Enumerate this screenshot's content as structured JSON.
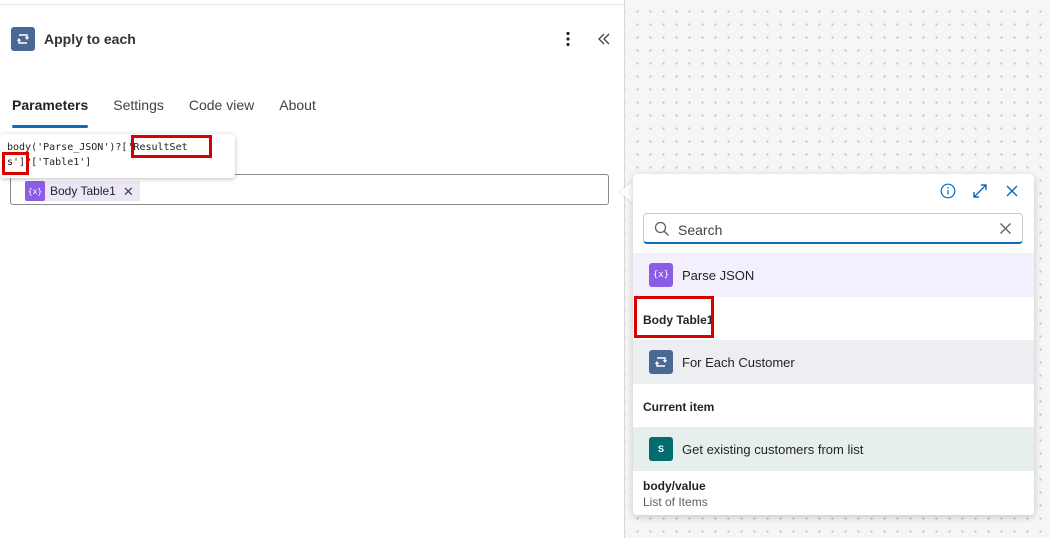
{
  "header": {
    "title": "Apply to each",
    "icon": "loop-icon"
  },
  "tabs": [
    {
      "label": "Parameters",
      "active": true
    },
    {
      "label": "Settings",
      "active": false
    },
    {
      "label": "Code view",
      "active": false
    },
    {
      "label": "About",
      "active": false
    }
  ],
  "tooltip": {
    "line1": "body('Parse_JSON')?['ResultSet",
    "line2": "s']?['Table1']"
  },
  "input": {
    "token_label": "Body Table1",
    "token_icon": "expression-icon"
  },
  "picker": {
    "search_placeholder": "Search",
    "groups": [
      {
        "label": "Parse JSON",
        "icon": "expression-icon",
        "color": "#8a5de6",
        "bg": "#f3effc"
      },
      {
        "label": "For Each Customer",
        "icon": "loop-icon",
        "color": "#486991",
        "bg": "#eceef2"
      },
      {
        "label": "Get existing customers from list",
        "icon": "sharepoint-icon",
        "color": "#036c70",
        "bg": "#e7eeee"
      }
    ],
    "items": [
      {
        "label": "Body Table1",
        "sub": ""
      },
      {
        "label": "Current item",
        "sub": ""
      },
      {
        "label": "body/value",
        "sub": "List of Items"
      }
    ]
  },
  "colors": {
    "accent": "#0f6cbd",
    "highlight": "#d90000"
  }
}
